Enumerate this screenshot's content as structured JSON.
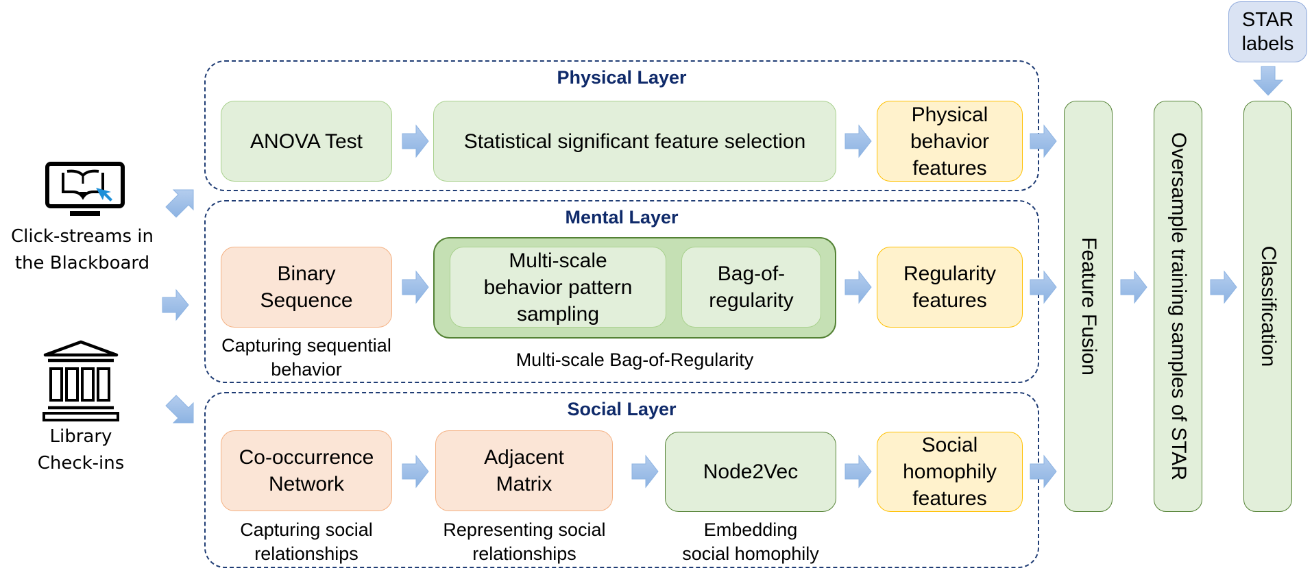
{
  "sources": [
    {
      "icon": "monitor-book-cursor-icon",
      "lines": [
        "Click-streams in",
        "the Blackboard"
      ]
    },
    {
      "icon": "library-building-icon",
      "lines": [
        "Library",
        "Check-ins"
      ]
    }
  ],
  "layers": {
    "physical": {
      "title": "Physical Layer",
      "steps": [
        {
          "label": "ANOVA Test"
        },
        {
          "label": "Statistical significant feature selection"
        },
        {
          "lines": [
            "Physical",
            "behavior",
            "features"
          ]
        }
      ]
    },
    "mental": {
      "title": "Mental Layer",
      "steps": [
        {
          "lines": [
            "Binary",
            "Sequence"
          ],
          "caption": [
            "Capturing sequential",
            "behavior"
          ]
        },
        {
          "inner": [
            {
              "lines": [
                "Multi-scale",
                "behavior pattern",
                "sampling"
              ]
            },
            {
              "lines": [
                "Bag-of-",
                "regularity"
              ]
            }
          ],
          "caption": "Multi-scale Bag-of-Regularity"
        },
        {
          "lines": [
            "Regularity",
            "features"
          ]
        }
      ]
    },
    "social": {
      "title": "Social Layer",
      "steps": [
        {
          "lines": [
            "Co-occurrence",
            "Network"
          ],
          "caption": [
            "Capturing social",
            "relationships"
          ]
        },
        {
          "lines": [
            "Adjacent",
            "Matrix"
          ],
          "caption": [
            "Representing social",
            "relationships"
          ]
        },
        {
          "label": "Node2Vec",
          "caption": [
            "Embedding",
            "social homophily"
          ]
        },
        {
          "lines": [
            "Social",
            "homophily",
            "features"
          ]
        }
      ]
    }
  },
  "pipeline": {
    "feature_fusion": "Feature Fusion",
    "oversample": "Oversample training samples of STAR",
    "classification": "Classification",
    "star_labels": [
      "STAR",
      "labels"
    ]
  },
  "colors": {
    "layer_border": "#1f3c74",
    "layer_title": "#0f2a6a",
    "green_fill": "#e2efda",
    "green_border": "#a9d18e",
    "green_dark_border": "#548235",
    "container_fill": "#c5e0b4",
    "orange_fill": "#fbe5d6",
    "orange_border": "#f4b183",
    "yellow_fill": "#fff2cc",
    "yellow_border": "#ffc000",
    "star_fill": "#dae3f3",
    "star_border": "#8faadc",
    "arrow_fill": "#9dbfe7"
  }
}
